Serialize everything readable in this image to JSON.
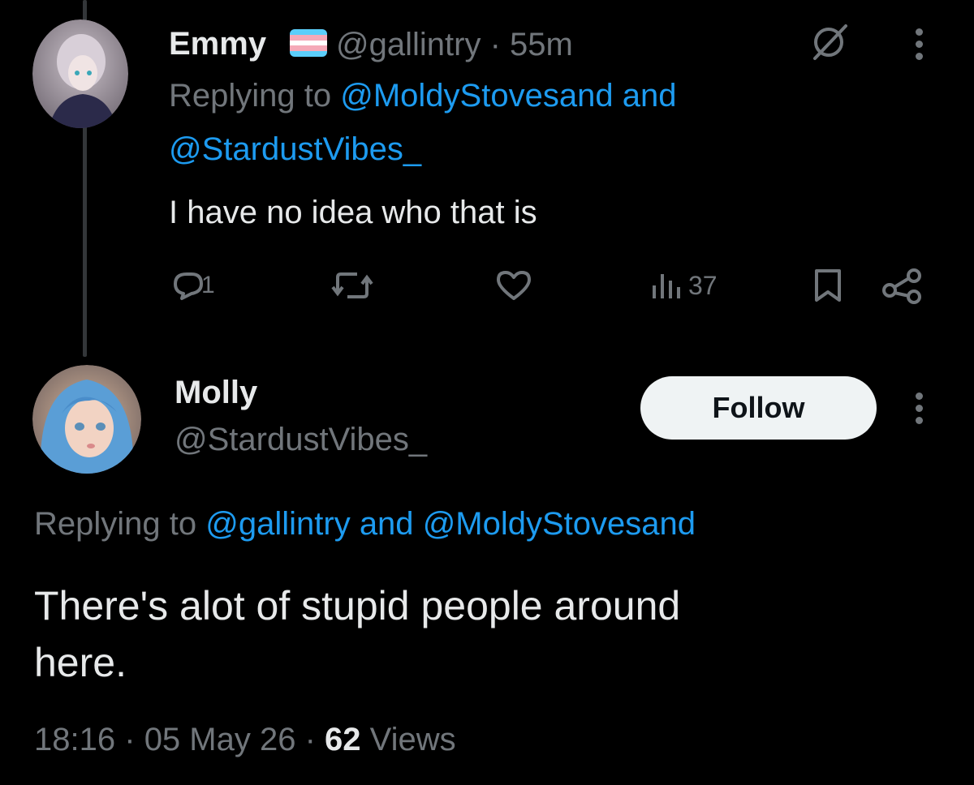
{
  "colors": {
    "background": "#000000",
    "text": "#e7e9ea",
    "muted": "#71767b",
    "link": "#1d9bf0",
    "follow_bg": "#eff3f4"
  },
  "reply": {
    "author_name": "Emmy",
    "flag_icon": "transgender-flag-icon",
    "handle": "@gallintry",
    "separator": "·",
    "time": "55m",
    "replying_prefix": "Replying to",
    "replying_user1": "@MoldyStovesand",
    "replying_and": "and",
    "replying_user2": "@StardustVibes_",
    "text": "I have no idea who that is",
    "actions": {
      "reply_count": "1",
      "views_count": "37"
    }
  },
  "main": {
    "author_name": "Molly",
    "handle": "@StardustVibes_",
    "follow_label": "Follow",
    "replying_prefix": "Replying to",
    "replying_user1": "@gallintry",
    "replying_and": "and",
    "replying_user2": "@MoldyStovesand",
    "text_line1": "There's alot of stupid people around",
    "text_line2": "here.",
    "time": "18:16",
    "sep1": "·",
    "date": "05 May 26",
    "sep2": "·",
    "views_count": "62",
    "views_label": "Views"
  }
}
